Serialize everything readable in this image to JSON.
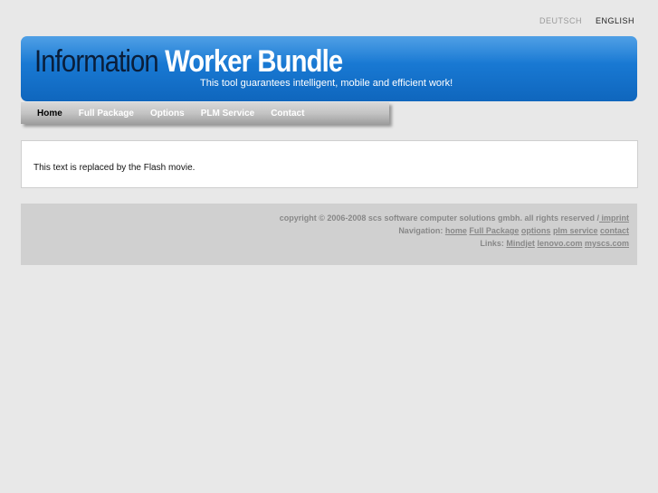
{
  "language": {
    "deutsch": "DEUTSCH",
    "english": "ENGLISH"
  },
  "header": {
    "title_part1": "Information",
    "title_part2": "Worker Bundle",
    "tagline": "This tool guarantees intelligent, mobile and efficient work!"
  },
  "nav": {
    "items": [
      "Home",
      "Full Package",
      "Options",
      "PLM Service",
      "Contact"
    ]
  },
  "content": {
    "text": "This text is replaced by the Flash movie."
  },
  "footer": {
    "copyright": "copyright © 2006-2008 scs software computer solutions gmbh. all rights reserved /",
    "imprint": " imprint",
    "nav_label": "Navigation:",
    "nav_links": [
      "home",
      "Full Package",
      "options",
      "plm service",
      "contact"
    ],
    "links_label": "Links:",
    "links": [
      "Mindjet",
      "lenovo.com",
      "myscs.com"
    ]
  },
  "colors": {
    "banner": "#1878d2",
    "page_bg": "#e8e8e8",
    "footer_bg": "#d0d0d0"
  }
}
